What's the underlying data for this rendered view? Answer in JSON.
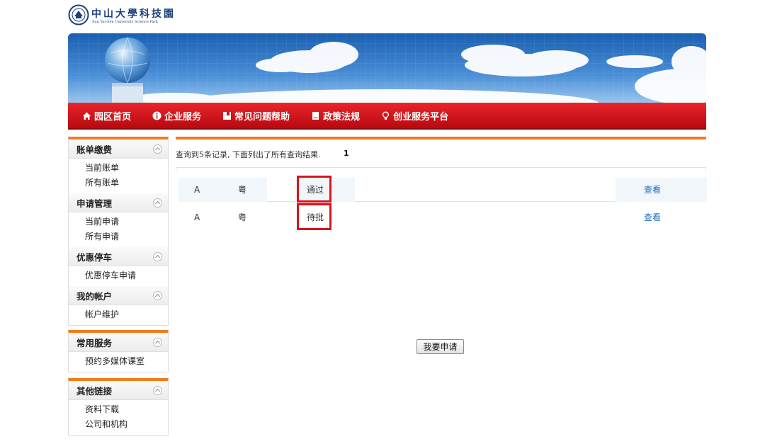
{
  "logo": {
    "name_cn": "中山大學科技園",
    "name_en": "Sun Yat-Sen University Science Park"
  },
  "nav": {
    "items": [
      {
        "label": "园区首页",
        "icon": "home-icon"
      },
      {
        "label": "企业服务",
        "icon": "info-icon"
      },
      {
        "label": "常见问题帮助",
        "icon": "bookmark-icon"
      },
      {
        "label": "政策法规",
        "icon": "document-icon"
      },
      {
        "label": "创业服务平台",
        "icon": "lightbulb-icon"
      }
    ]
  },
  "sidebar": {
    "groups": [
      {
        "title": "账单缴费",
        "links": [
          "当前账单",
          "所有账单"
        ]
      },
      {
        "title": "申请管理",
        "links": [
          "当前申请",
          "所有申请"
        ]
      },
      {
        "title": "优惠停车",
        "links": [
          "优惠停车申请"
        ]
      },
      {
        "title": "我的帐户",
        "links": [
          "帐户维护"
        ]
      },
      {
        "title": "常用服务",
        "links": [
          "预约多媒体课室"
        ]
      },
      {
        "title": "其他链接",
        "links": [
          "资料下载",
          "公司和机构"
        ]
      }
    ]
  },
  "main": {
    "result_text": "查询到5条记录, 下面列出了所有查询结果.",
    "result_count": "1",
    "rows": [
      {
        "col1": "A",
        "col2": "粤",
        "status": "通过",
        "action": "查看"
      },
      {
        "col1": "A",
        "col2": "粤",
        "status": "待批",
        "action": "查看"
      }
    ],
    "apply_button": "我要申请"
  },
  "colors": {
    "nav_red": "#d4151b",
    "accent_orange": "#f07c1c",
    "link_blue": "#1a6ec0",
    "highlight_red": "#d8141c"
  }
}
